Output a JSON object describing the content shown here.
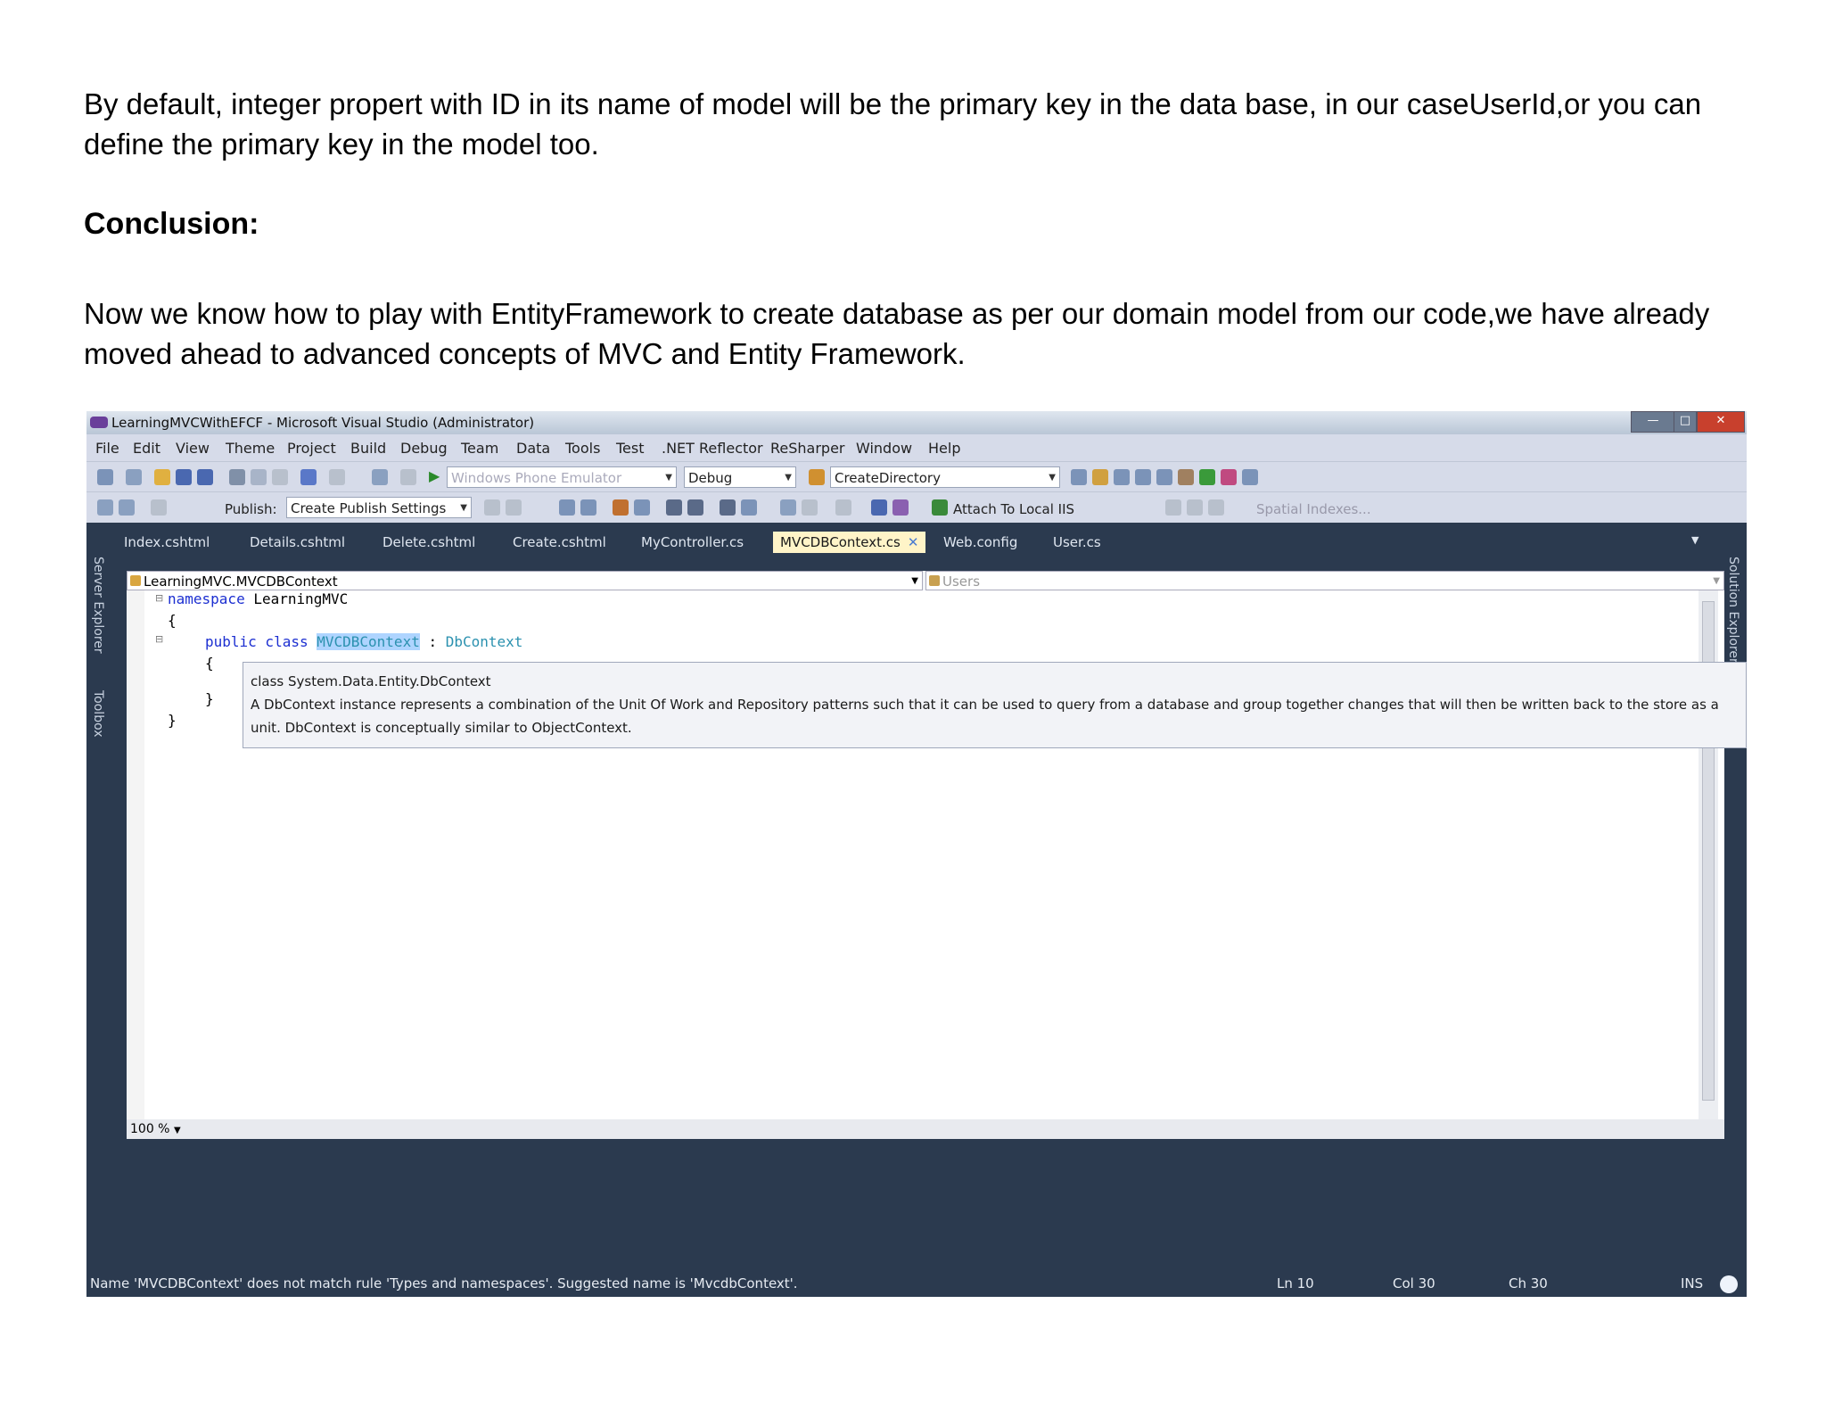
{
  "document": {
    "paragraph1": "By default, integer propert with ID in its name of model will be the primary key in the data base, in our caseUserId,or you can define the primary key in the model too.",
    "heading": "Conclusion:",
    "paragraph2": "Now we know how to play with EntityFramework to create database as per our domain model from our code,we have already moved ahead to advanced concepts of MVC and Entity Framework."
  },
  "vs": {
    "window_title": "LearningMVCWithEFCF - Microsoft Visual Studio (Administrator)",
    "menu": [
      "File",
      "Edit",
      "View",
      "Theme",
      "Project",
      "Build",
      "Debug",
      "Team",
      "Data",
      "Tools",
      "Test",
      ".NET Reflector",
      "ReSharper",
      "Window",
      "Help"
    ],
    "toolbar1": {
      "emulator": "Windows Phone Emulator",
      "config": "Debug",
      "find": "CreateDirectory"
    },
    "toolbar2": {
      "publish_label": "Publish:",
      "publish_value": "Create Publish Settings",
      "attach": "Attach To Local IIS",
      "spatial": "Spatial Indexes..."
    },
    "tabs": [
      "Index.cshtml",
      "Details.cshtml",
      "Delete.cshtml",
      "Create.cshtml",
      "MyController.cs",
      "MVCDBContext.cs",
      "Web.config",
      "User.cs"
    ],
    "active_tab_close": "✕",
    "left_panels": [
      "Server Explorer",
      "Toolbox"
    ],
    "right_panels": [
      "Solution Explorer"
    ],
    "nav_type": "LearningMVC.MVCDBContext",
    "nav_member": "Users",
    "code": {
      "kw_namespace": "namespace",
      "ns_name": " LearningMVC",
      "brace_open": "{",
      "kw_public_class": "public class",
      "class_name": "MVCDBContext",
      "colon": " : ",
      "base_type": "DbContext",
      "inner_open": "{",
      "inner_close": "}",
      "brace_close": "}"
    },
    "tooltip": {
      "signature": "class System.Data.Entity.DbContext",
      "description": "A DbContext instance represents a combination of the Unit Of Work and Repository patterns such that it can be used to query from a database and group together changes that will then be written back to the store as a unit.  DbContext is conceptually similar to ObjectContext."
    },
    "zoom": "100 %",
    "status": {
      "message": "Name 'MVCDBContext' does not match rule 'Types and namespaces'. Suggested name is 'MvcdbContext'.",
      "ln": "Ln 10",
      "col": "Col 30",
      "ch": "Ch 30",
      "mode": "INS"
    }
  }
}
